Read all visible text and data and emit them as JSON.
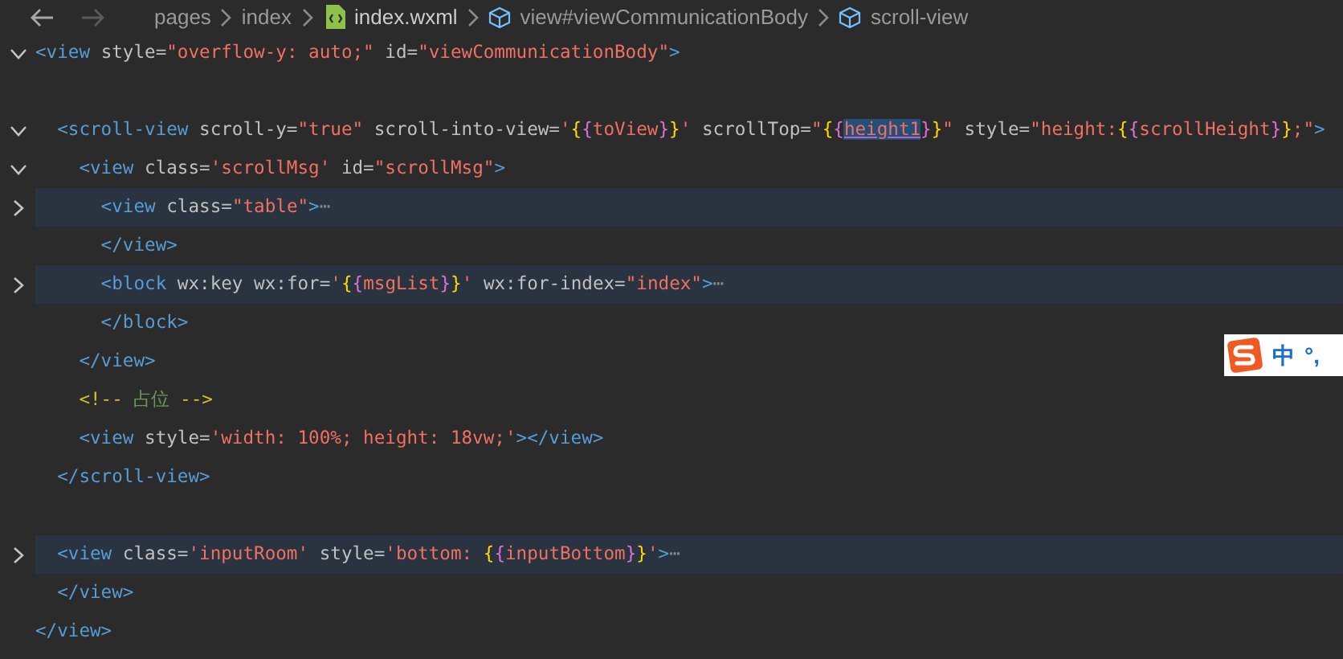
{
  "breadcrumb": {
    "nav": [
      {
        "kind": "back",
        "disabled": false
      },
      {
        "kind": "forward",
        "disabled": true
      }
    ],
    "items": [
      {
        "kind": "folder",
        "label": "pages"
      },
      {
        "kind": "folder",
        "label": "index"
      },
      {
        "kind": "file",
        "label": "index.wxml"
      },
      {
        "kind": "element",
        "label": "view#viewCommunicationBody"
      },
      {
        "kind": "element",
        "label": "scroll-view"
      }
    ]
  },
  "lines": [
    {
      "kind": "code",
      "expanded": true,
      "tokens": [
        {
          "kind": "tag",
          "s": "<view"
        },
        {
          "kind": "attr",
          "s": " style="
        },
        {
          "kind": "string",
          "s": "\"overflow-y: auto;\""
        },
        {
          "kind": "attr",
          "s": " id="
        },
        {
          "kind": "string",
          "s": "\"viewCommunicationBody\""
        },
        {
          "kind": "tag",
          "s": ">"
        }
      ]
    },
    {
      "kind": "blank"
    },
    {
      "kind": "code",
      "expanded": true,
      "tokens": [
        {
          "kind": "tag",
          "s": "  <scroll-view"
        },
        {
          "kind": "attr",
          "s": " scroll-y="
        },
        {
          "kind": "string",
          "s": "\"true\""
        },
        {
          "kind": "attr",
          "s": " scroll-into-view="
        },
        {
          "kind": "string",
          "s": "'"
        },
        {
          "kind": "brace",
          "s": "{"
        },
        {
          "kind": "nested",
          "s": "{"
        },
        {
          "kind": "variable",
          "s": "toView"
        },
        {
          "kind": "nested",
          "s": "}"
        },
        {
          "kind": "brace",
          "s": "}"
        },
        {
          "kind": "string",
          "s": "'"
        },
        {
          "kind": "attr",
          "s": " scrollTop="
        },
        {
          "kind": "string",
          "s": "\""
        },
        {
          "kind": "brace",
          "s": "{"
        },
        {
          "kind": "nested",
          "s": "{"
        },
        {
          "kind": "selection",
          "s": "height1"
        },
        {
          "kind": "nested",
          "s": "}"
        },
        {
          "kind": "brace",
          "s": "}"
        },
        {
          "kind": "string",
          "s": "\""
        },
        {
          "kind": "attr",
          "s": " style="
        },
        {
          "kind": "string",
          "s": "\"height:"
        },
        {
          "kind": "brace",
          "s": "{"
        },
        {
          "kind": "nested",
          "s": "{"
        },
        {
          "kind": "variable",
          "s": "scrollHeight"
        },
        {
          "kind": "nested",
          "s": "}"
        },
        {
          "kind": "brace",
          "s": "}"
        },
        {
          "kind": "string",
          "s": ";\""
        },
        {
          "kind": "tag",
          "s": ">"
        }
      ]
    },
    {
      "kind": "code",
      "expanded": true,
      "tokens": [
        {
          "kind": "tag",
          "s": "    <view"
        },
        {
          "kind": "attr",
          "s": " class="
        },
        {
          "kind": "string",
          "s": "'scrollMsg'"
        },
        {
          "kind": "attr",
          "s": " id="
        },
        {
          "kind": "string",
          "s": "\"scrollMsg\""
        },
        {
          "kind": "tag",
          "s": ">"
        }
      ]
    },
    {
      "kind": "code",
      "expanded": false,
      "tokens": [
        {
          "kind": "tag",
          "s": "      <view"
        },
        {
          "kind": "attr",
          "s": " class="
        },
        {
          "kind": "string",
          "s": "\"table\""
        },
        {
          "kind": "tag",
          "s": ">"
        },
        {
          "kind": "ellipsis",
          "s": "⋯"
        }
      ]
    },
    {
      "kind": "code",
      "tokens": [
        {
          "kind": "tag",
          "s": "      </view>"
        }
      ]
    },
    {
      "kind": "code",
      "expanded": false,
      "tokens": [
        {
          "kind": "tag",
          "s": "      <block"
        },
        {
          "kind": "attr",
          "s": " wx:key wx:for="
        },
        {
          "kind": "string",
          "s": "'"
        },
        {
          "kind": "brace",
          "s": "{"
        },
        {
          "kind": "nested",
          "s": "{"
        },
        {
          "kind": "variable",
          "s": "msgList"
        },
        {
          "kind": "nested",
          "s": "}"
        },
        {
          "kind": "brace",
          "s": "}"
        },
        {
          "kind": "string",
          "s": "'"
        },
        {
          "kind": "attr",
          "s": " wx:for-index="
        },
        {
          "kind": "string",
          "s": "\"index\""
        },
        {
          "kind": "tag",
          "s": ">"
        },
        {
          "kind": "ellipsis",
          "s": "⋯"
        }
      ]
    },
    {
      "kind": "code",
      "tokens": [
        {
          "kind": "tag",
          "s": "      </block>"
        }
      ]
    },
    {
      "kind": "code",
      "tokens": [
        {
          "kind": "tag",
          "s": "    </view>"
        }
      ]
    },
    {
      "kind": "code",
      "tokens": [
        {
          "kind": "comment",
          "s": "    <!--"
        },
        {
          "kind": "note",
          "s": " 占位 "
        },
        {
          "kind": "comment",
          "s": "-->"
        }
      ]
    },
    {
      "kind": "code",
      "tokens": [
        {
          "kind": "tag",
          "s": "    <view"
        },
        {
          "kind": "attr",
          "s": " style="
        },
        {
          "kind": "string",
          "s": "'width: 100%; height: 18vw;'"
        },
        {
          "kind": "tag",
          "s": "></view>"
        }
      ]
    },
    {
      "kind": "code",
      "tokens": [
        {
          "kind": "tag",
          "s": "  </scroll-view>"
        }
      ]
    },
    {
      "kind": "blank"
    },
    {
      "kind": "code",
      "expanded": false,
      "tokens": [
        {
          "kind": "tag",
          "s": "  <view"
        },
        {
          "kind": "attr",
          "s": " class="
        },
        {
          "kind": "string",
          "s": "'inputRoom'"
        },
        {
          "kind": "attr",
          "s": " style="
        },
        {
          "kind": "string",
          "s": "'bottom: "
        },
        {
          "kind": "brace",
          "s": "{"
        },
        {
          "kind": "nested",
          "s": "{"
        },
        {
          "kind": "variable",
          "s": "inputBottom"
        },
        {
          "kind": "nested",
          "s": "}"
        },
        {
          "kind": "brace",
          "s": "}"
        },
        {
          "kind": "string",
          "s": "'"
        },
        {
          "kind": "tag",
          "s": ">"
        },
        {
          "kind": "ellipsis",
          "s": "⋯"
        }
      ]
    },
    {
      "kind": "code",
      "tokens": [
        {
          "kind": "tag",
          "s": "  </view>"
        }
      ]
    },
    {
      "kind": "code",
      "tokens": [
        {
          "kind": "tag",
          "s": "</view>"
        }
      ]
    }
  ],
  "ime": {
    "mode": "中",
    "punct": "°,"
  }
}
